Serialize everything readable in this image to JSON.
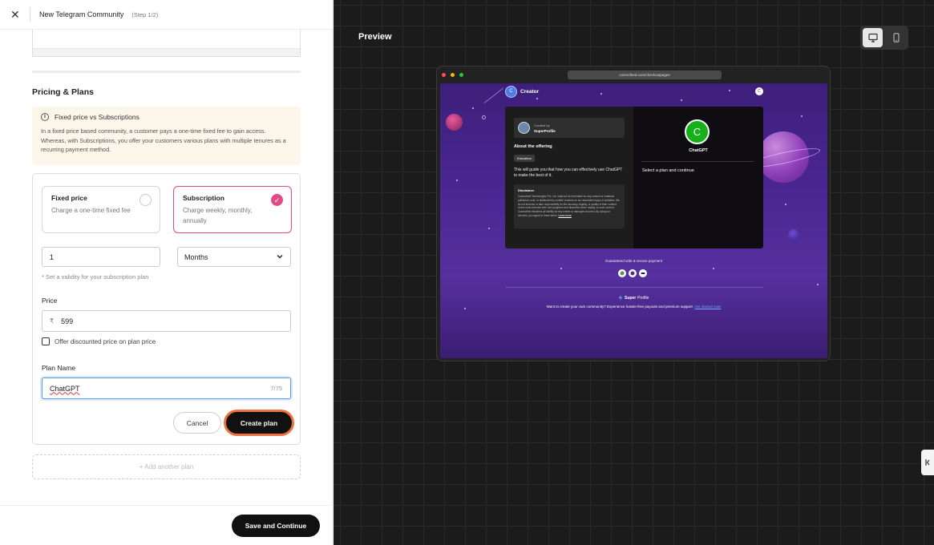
{
  "header": {
    "title": "New Telegram Community",
    "step": "(Step 1/2)"
  },
  "pricing": {
    "section_title": "Pricing & Plans",
    "info_title": "Fixed price vs Subscriptions",
    "info_body": "In a fixed price based community, a customer pays a one-time fixed fee to gain access. Whereas, with Subscriptions, you offer your customers various plans with multiple tenures as a recurring payment method.",
    "fixed": {
      "title": "Fixed price",
      "desc": "Charge a one-time fixed fee",
      "selected": false
    },
    "subscription": {
      "title": "Subscription",
      "desc": "Charge weekly, monthly, annually",
      "selected": true
    },
    "validity_value": "1",
    "validity_unit": "Months",
    "validity_hint": "* Set a validity for your subscription plan",
    "price_label": "Price",
    "currency_symbol": "₹",
    "price_value": "599",
    "discount_label": "Offer discounted price on plan price",
    "plan_name_label": "Plan Name",
    "plan_name_value": "ChatGPT",
    "plan_name_counter": "7/75",
    "cancel_label": "Cancel",
    "create_label": "Create plan",
    "add_plan_label": "+ Add another plan"
  },
  "footer": {
    "save_label": "Save and Continue"
  },
  "preview": {
    "label": "Preview",
    "url": "cosmofeed.com/checkoutpages",
    "creator_initial": "C",
    "creator_name": "Creator",
    "top_right_initial": "C",
    "created_by_label": "Created by",
    "created_by_name": "SuperProfile",
    "about_title": "About the offering",
    "tag": "Education",
    "description": "This will guide you that how you can effectively use ChatGPT to make the best of it.",
    "disclaimer_title": "Disclaimer",
    "disclaimer_body": "Cosmofeed Technologies Pvt. Ltd. shall not be held liable for any content or materials published, sold, or distributed by content creators on our associated apps or websites. We do not endorse or take responsibility for the accuracy, legality, or quality of their content. Users must exercise their own judgment and discretion when relying on such content. Cosmofeed disclaims all liability for any losses or damages incurred. By using our services, you agree to these terms.",
    "learn_more": "Learn more",
    "product_initial": "C",
    "product_name": "ChatGPT",
    "select_plan_text": "Select a plan and continue",
    "secure_text": "Guaranteed safe & secure payment",
    "brand_super": "Super",
    "brand_profile": "Profile",
    "cta_text": "Want to create your own community? Experience hassle-free payouts and premium support.",
    "cta_link": "Get started now!"
  },
  "colors": {
    "accent_pink": "#e14c86",
    "create_outline": "#ef6f3d",
    "product_avatar": "#15b11a"
  }
}
